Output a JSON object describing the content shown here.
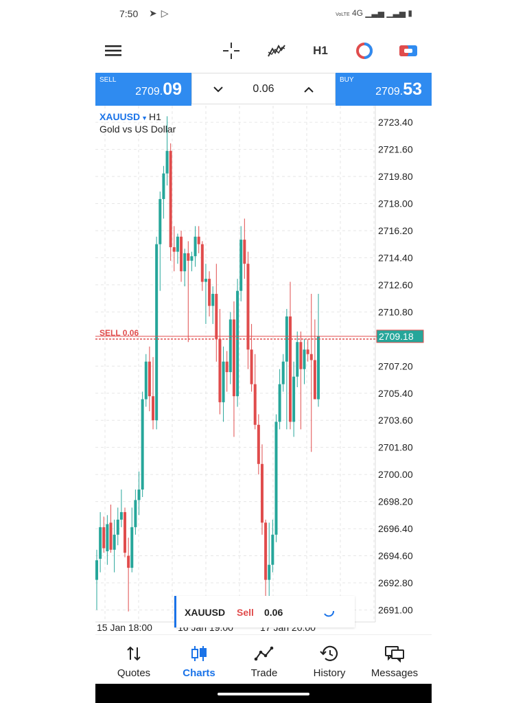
{
  "status_bar": {
    "time": "7:50",
    "network": "4G"
  },
  "toolbar": {
    "timeframe": "H1"
  },
  "trade_panel": {
    "sell_label": "SELL",
    "sell_price_prefix": "2709.",
    "sell_price_big": "09",
    "buy_label": "BUY",
    "buy_price_prefix": "2709.",
    "buy_price_big": "53",
    "volume": "0.06"
  },
  "chart_header": {
    "symbol": "XAUUSD",
    "timeframe": "H1",
    "description": "Gold vs US Dollar"
  },
  "order_line": {
    "label": "SELL 0.06",
    "price": 2709.09
  },
  "colors": {
    "bull": "#26a69a",
    "bear": "#e04c4c",
    "accent": "#2f8bf0",
    "active_tab": "#1a73e8"
  },
  "chart_data": {
    "type": "candlestick",
    "price_axis_labels": [
      "2723.40",
      "2721.60",
      "2719.80",
      "2718.00",
      "2716.20",
      "2714.40",
      "2712.60",
      "2710.80",
      "2707.20",
      "2705.40",
      "2703.60",
      "2701.80",
      "2700.00",
      "2698.20",
      "2696.40",
      "2694.60",
      "2692.80",
      "2691.00"
    ],
    "current_price_label": "2709.18",
    "time_labels": [
      "15 Jan 18:00",
      "16 Jan 19:00",
      "17 Jan 20:00"
    ],
    "ylim": [
      2690.2,
      2724.5
    ],
    "candles": [
      {
        "o": 2693.0,
        "h": 2695.0,
        "l": 2691.0,
        "c": 2694.3
      },
      {
        "o": 2694.4,
        "h": 2697.5,
        "l": 2693.5,
        "c": 2696.5
      },
      {
        "o": 2696.5,
        "h": 2697.2,
        "l": 2694.8,
        "c": 2695.1
      },
      {
        "o": 2694.9,
        "h": 2697.3,
        "l": 2694.0,
        "c": 2696.7
      },
      {
        "o": 2696.8,
        "h": 2698.0,
        "l": 2694.8,
        "c": 2695.0
      },
      {
        "o": 2695.0,
        "h": 2697.0,
        "l": 2693.5,
        "c": 2696.0
      },
      {
        "o": 2696.0,
        "h": 2697.8,
        "l": 2695.3,
        "c": 2697.0
      },
      {
        "o": 2697.0,
        "h": 2699.0,
        "l": 2696.5,
        "c": 2697.5
      },
      {
        "o": 2697.5,
        "h": 2697.8,
        "l": 2694.5,
        "c": 2694.8
      },
      {
        "o": 2694.6,
        "h": 2695.8,
        "l": 2690.9,
        "c": 2693.8
      },
      {
        "o": 2693.8,
        "h": 2697.8,
        "l": 2693.5,
        "c": 2696.5
      },
      {
        "o": 2696.5,
        "h": 2699.0,
        "l": 2696.0,
        "c": 2698.3
      },
      {
        "o": 2698.3,
        "h": 2700.2,
        "l": 2697.3,
        "c": 2699.0
      },
      {
        "o": 2699.0,
        "h": 2705.5,
        "l": 2698.5,
        "c": 2705.0
      },
      {
        "o": 2705.0,
        "h": 2708.0,
        "l": 2704.5,
        "c": 2707.5
      },
      {
        "o": 2707.5,
        "h": 2708.5,
        "l": 2704.2,
        "c": 2705.2
      },
      {
        "o": 2705.2,
        "h": 2707.8,
        "l": 2703.0,
        "c": 2703.6
      },
      {
        "o": 2703.6,
        "h": 2715.8,
        "l": 2703.0,
        "c": 2715.3
      },
      {
        "o": 2715.3,
        "h": 2718.8,
        "l": 2712.2,
        "c": 2718.3
      },
      {
        "o": 2718.3,
        "h": 2720.5,
        "l": 2717.0,
        "c": 2720.0
      },
      {
        "o": 2720.0,
        "h": 2723.8,
        "l": 2719.2,
        "c": 2721.5
      },
      {
        "o": 2721.5,
        "h": 2722.0,
        "l": 2714.2,
        "c": 2715.1
      },
      {
        "o": 2715.1,
        "h": 2716.5,
        "l": 2713.5,
        "c": 2714.8
      },
      {
        "o": 2714.8,
        "h": 2716.0,
        "l": 2714.0,
        "c": 2715.8
      },
      {
        "o": 2715.8,
        "h": 2716.2,
        "l": 2712.8,
        "c": 2713.5
      },
      {
        "o": 2713.5,
        "h": 2715.0,
        "l": 2712.5,
        "c": 2714.7
      },
      {
        "o": 2714.7,
        "h": 2715.5,
        "l": 2708.8,
        "c": 2714.2
      },
      {
        "o": 2714.2,
        "h": 2714.8,
        "l": 2713.5,
        "c": 2714.5
      },
      {
        "o": 2714.5,
        "h": 2716.5,
        "l": 2713.8,
        "c": 2715.8
      },
      {
        "o": 2715.8,
        "h": 2716.5,
        "l": 2714.7,
        "c": 2715.3
      },
      {
        "o": 2715.3,
        "h": 2715.5,
        "l": 2712.2,
        "c": 2712.8
      },
      {
        "o": 2712.8,
        "h": 2714.0,
        "l": 2710.0,
        "c": 2713.0
      },
      {
        "o": 2713.0,
        "h": 2713.5,
        "l": 2710.5,
        "c": 2711.2
      },
      {
        "o": 2711.2,
        "h": 2712.5,
        "l": 2710.0,
        "c": 2712.0
      },
      {
        "o": 2712.0,
        "h": 2714.0,
        "l": 2707.5,
        "c": 2709.0
      },
      {
        "o": 2709.0,
        "h": 2711.0,
        "l": 2704.0,
        "c": 2704.8
      },
      {
        "o": 2704.8,
        "h": 2708.5,
        "l": 2703.5,
        "c": 2707.5
      },
      {
        "o": 2707.5,
        "h": 2708.2,
        "l": 2705.5,
        "c": 2706.8
      },
      {
        "o": 2706.8,
        "h": 2710.8,
        "l": 2706.0,
        "c": 2710.3
      },
      {
        "o": 2710.3,
        "h": 2711.5,
        "l": 2702.5,
        "c": 2705.2
      },
      {
        "o": 2705.2,
        "h": 2713.0,
        "l": 2704.5,
        "c": 2712.2
      },
      {
        "o": 2712.2,
        "h": 2716.5,
        "l": 2711.5,
        "c": 2715.6
      },
      {
        "o": 2715.6,
        "h": 2717.0,
        "l": 2713.0,
        "c": 2714.0
      },
      {
        "o": 2714.0,
        "h": 2714.8,
        "l": 2707.0,
        "c": 2708.3
      },
      {
        "o": 2708.3,
        "h": 2710.0,
        "l": 2705.5,
        "c": 2706.0
      },
      {
        "o": 2706.0,
        "h": 2708.0,
        "l": 2703.0,
        "c": 2703.3
      },
      {
        "o": 2703.3,
        "h": 2704.0,
        "l": 2700.0,
        "c": 2700.7
      },
      {
        "o": 2700.7,
        "h": 2702.0,
        "l": 2696.0,
        "c": 2696.8
      },
      {
        "o": 2696.8,
        "h": 2697.0,
        "l": 2691.5,
        "c": 2693.0
      },
      {
        "o": 2693.0,
        "h": 2696.8,
        "l": 2691.0,
        "c": 2694.0
      },
      {
        "o": 2694.0,
        "h": 2697.0,
        "l": 2693.5,
        "c": 2696.0
      },
      {
        "o": 2696.0,
        "h": 2704.0,
        "l": 2695.5,
        "c": 2703.5
      },
      {
        "o": 2703.5,
        "h": 2707.0,
        "l": 2703.0,
        "c": 2706.0
      },
      {
        "o": 2706.0,
        "h": 2708.0,
        "l": 2705.5,
        "c": 2707.5
      },
      {
        "o": 2707.5,
        "h": 2711.0,
        "l": 2703.0,
        "c": 2710.5
      },
      {
        "o": 2710.5,
        "h": 2712.8,
        "l": 2703.0,
        "c": 2703.5
      },
      {
        "o": 2703.5,
        "h": 2707.5,
        "l": 2702.5,
        "c": 2706.5
      },
      {
        "o": 2706.5,
        "h": 2709.5,
        "l": 2705.8,
        "c": 2708.8
      },
      {
        "o": 2708.8,
        "h": 2709.5,
        "l": 2703.0,
        "c": 2707.0
      },
      {
        "o": 2707.0,
        "h": 2709.0,
        "l": 2706.0,
        "c": 2708.3
      },
      {
        "o": 2708.3,
        "h": 2709.0,
        "l": 2707.5,
        "c": 2708.0
      },
      {
        "o": 2708.0,
        "h": 2712.0,
        "l": 2701.5,
        "c": 2707.6
      },
      {
        "o": 2707.6,
        "h": 2710.3,
        "l": 2705.0,
        "c": 2705.0
      },
      {
        "o": 2705.0,
        "h": 2712.0,
        "l": 2704.5,
        "c": 2709.2
      }
    ]
  },
  "order_toast": {
    "symbol": "XAUUSD",
    "type": "Sell",
    "volume": "0.06"
  },
  "bottom_nav": {
    "items": [
      {
        "label": "Quotes",
        "icon": "quotes-icon"
      },
      {
        "label": "Charts",
        "icon": "charts-icon",
        "active": true
      },
      {
        "label": "Trade",
        "icon": "trade-icon"
      },
      {
        "label": "History",
        "icon": "history-icon"
      },
      {
        "label": "Messages",
        "icon": "messages-icon"
      }
    ]
  }
}
